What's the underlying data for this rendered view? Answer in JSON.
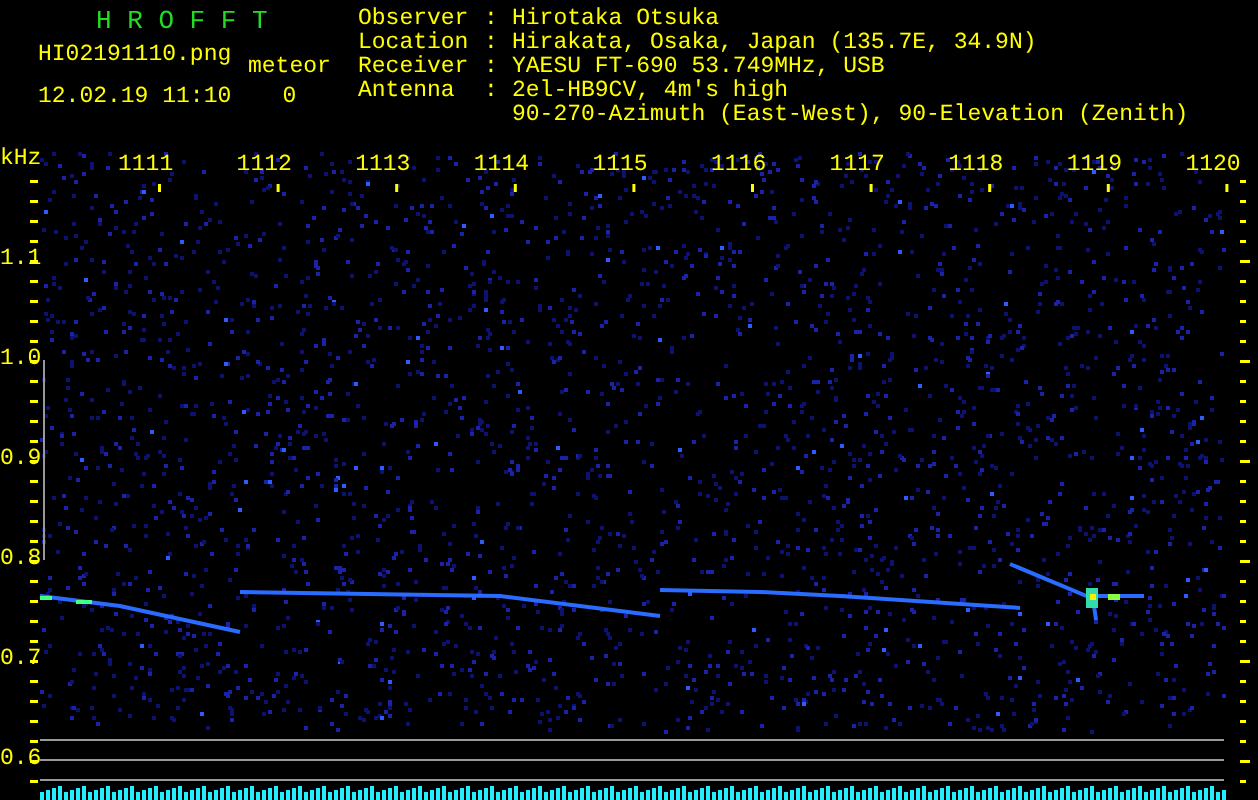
{
  "header": {
    "app_title": "H R O F F T",
    "file_name": "HI02191110.png",
    "timestamp": "12.02.19 11:10",
    "meteor_label": "meteor",
    "meteor_count": "0",
    "info": [
      {
        "label": "Observer",
        "separator": ":",
        "value": "Hirotaka Otsuka"
      },
      {
        "label": "Location",
        "separator": ":",
        "value": "Hirakata, Osaka, Japan (135.7E, 34.9N)"
      },
      {
        "label": "Receiver",
        "separator": ":",
        "value": "YAESU FT-690 53.749MHz, USB"
      },
      {
        "label": "Antenna",
        "separator": ":",
        "value": "2el-HB9CV, 4m's high"
      },
      {
        "value": "90-270-Azimuth (East-West), 90-Elevation (Zenith)"
      }
    ]
  },
  "spectrogram": {
    "y_unit": "kHz",
    "x_labels": [
      "1111",
      "1112",
      "1113",
      "1114",
      "1115",
      "1116",
      "1117",
      "1118",
      "1119",
      "1120"
    ],
    "y_labels": [
      "1.1",
      "1.0",
      "0.9",
      "0.8",
      "0.7",
      "0.6"
    ]
  }
}
